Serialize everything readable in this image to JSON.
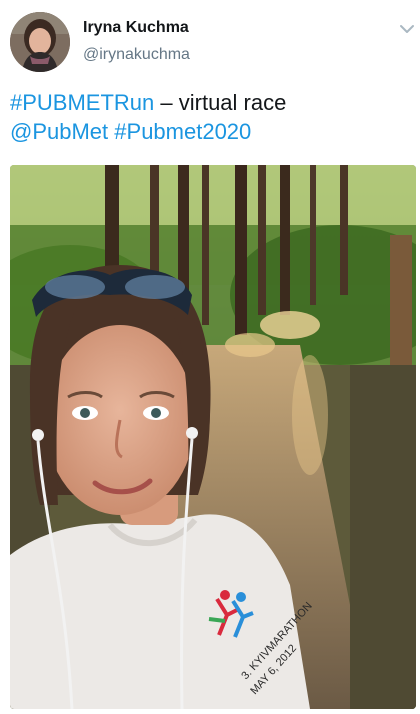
{
  "author": {
    "display_name": "Iryna Kuchma",
    "handle": "@irynakuchma",
    "avatar_icon": "user-avatar"
  },
  "tweet": {
    "hashtag_run": "#PUBMETRun",
    "text_middle": " – virtual race",
    "mention": "@PubMet",
    "space": " ",
    "hashtag_2020": "#Pubmet2020"
  },
  "media": {
    "shirt_text_line1": "3. KYIVMARATHON",
    "shirt_text_line2": "MAY 6, 2012"
  },
  "icons": {
    "menu": "chevron-down-icon"
  },
  "colors": {
    "link": "#1b95e0",
    "handle": "#657786",
    "text": "#14171a",
    "chevron": "#aab8c2"
  }
}
